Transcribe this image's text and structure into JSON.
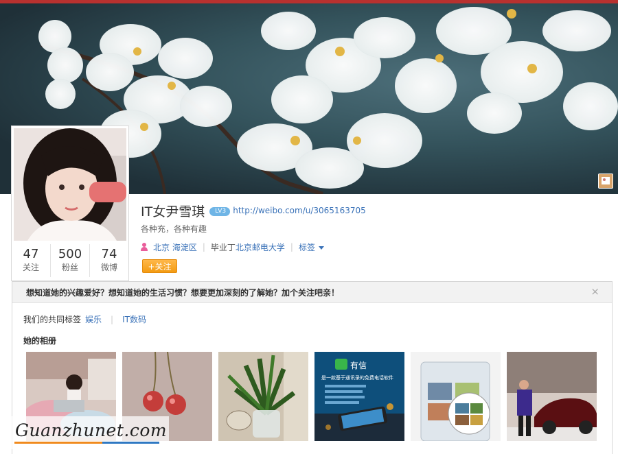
{
  "profile": {
    "name": "IT女尹雪琪",
    "vip_badge": "LV3",
    "url": "http://weibo.com/u/3065163705",
    "bio": "各种充，各种有趣",
    "location": "北京 海淀区",
    "school_prefix": "毕业丁",
    "school": "北京邮电大学",
    "tags_link": "标签",
    "follow_button": "+关注"
  },
  "stats": [
    {
      "value": "47",
      "label": "关注"
    },
    {
      "value": "500",
      "label": "粉丝"
    },
    {
      "value": "74",
      "label": "微博"
    }
  ],
  "panel": {
    "title": "想知道她的兴趣爱好？想知道她的生活习惯？想要更加深刻的了解她？加个关注吧亲！",
    "close": "×",
    "common_tags_label": "我们的共同标签",
    "common_tags": [
      "娱乐",
      "IT数码"
    ],
    "album_title": "她的相册"
  },
  "photos": [
    "photo-room",
    "photo-cherries",
    "photo-plant",
    "photo-youxin-ad",
    "photo-phone-screens",
    "photo-man-car"
  ],
  "youxin": {
    "brand": "有信",
    "headline": "是一款基于通讯录的免费电话软件"
  },
  "watermark": "Guanzhunet.com",
  "colors": {
    "top_bar": "#b8312f",
    "link": "#3a72b8",
    "follow_button": "#f39b12"
  }
}
